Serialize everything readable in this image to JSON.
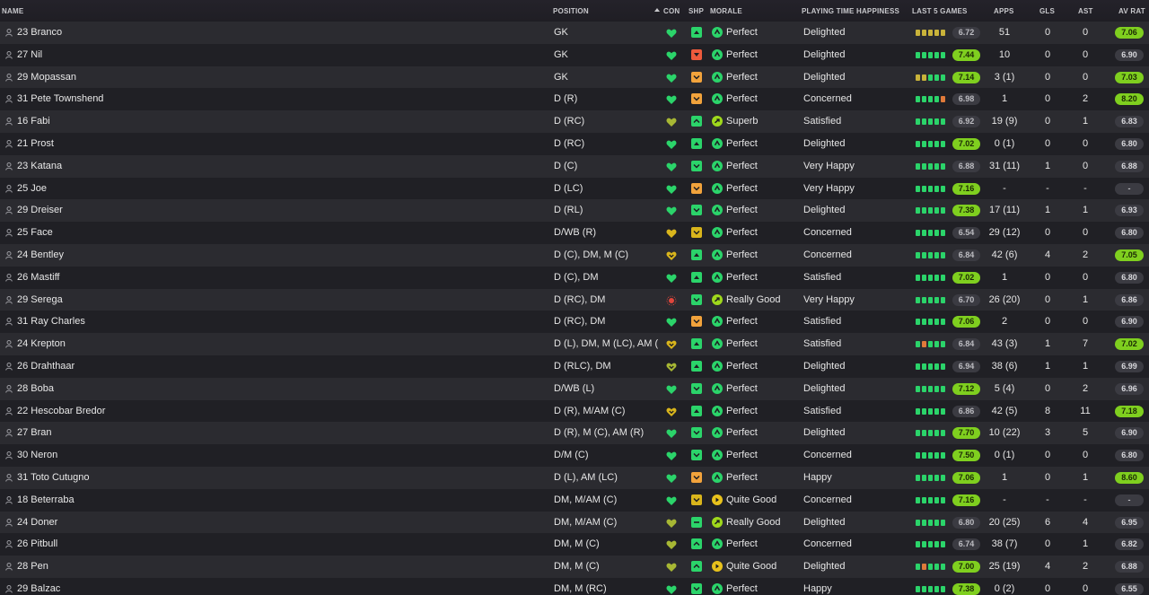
{
  "headers": {
    "name": "NAME",
    "position": "POSITION",
    "con": "CON",
    "shp": "SHP",
    "morale": "MORALE",
    "playing_time": "PLAYING TIME HAPPINESS",
    "last5": "LAST 5 GAMES",
    "apps": "APPS",
    "gls": "GLS",
    "ast": "AST",
    "av_rat": "AV RAT"
  },
  "colors": {
    "green": "#2bd46a",
    "lime": "#7fcf1f",
    "yellow": "#d9b51c",
    "orange": "#f2a33c",
    "red": "#ee5a3c",
    "olive": "#a7b734",
    "injury": "#e0463c"
  },
  "players": [
    {
      "name": "23 Branco",
      "position": "GK",
      "con": "green-heart",
      "shp": "green-up-small",
      "morale_icon": "green-up",
      "morale": "Perfect",
      "pt": "Delighted",
      "last5": [
        "yel",
        "yel",
        "yel",
        "yel",
        "yel"
      ],
      "last": "6.72",
      "last_hl": false,
      "apps": "51",
      "gls": "0",
      "ast": "0",
      "avr": "7.06",
      "avr_hl": true
    },
    {
      "name": "27 Nil",
      "position": "GK",
      "con": "green-heart",
      "shp": "red-down-small",
      "morale_icon": "green-up",
      "morale": "Perfect",
      "pt": "Delighted",
      "last5": [
        "grn",
        "grn",
        "grn",
        "grn",
        "grn"
      ],
      "last": "7.44",
      "last_hl": true,
      "apps": "10",
      "gls": "0",
      "ast": "0",
      "avr": "6.90",
      "avr_hl": false
    },
    {
      "name": "29 Mopassan",
      "position": "GK",
      "con": "green-heart",
      "shp": "orange-down",
      "morale_icon": "green-up",
      "morale": "Perfect",
      "pt": "Delighted",
      "last5": [
        "yel",
        "yel",
        "grn",
        "grn",
        "grn"
      ],
      "last": "7.14",
      "last_hl": true,
      "apps": "3 (1)",
      "gls": "0",
      "ast": "0",
      "avr": "7.03",
      "avr_hl": true
    },
    {
      "name": "31 Pete Townshend",
      "position": "D (R)",
      "con": "green-heart",
      "shp": "orange-down",
      "morale_icon": "green-up",
      "morale": "Perfect",
      "pt": "Concerned",
      "last5": [
        "grn",
        "grn",
        "grn",
        "grn",
        "ora"
      ],
      "last": "6.98",
      "last_hl": false,
      "apps": "1",
      "gls": "0",
      "ast": "2",
      "avr": "8.20",
      "avr_hl": true
    },
    {
      "name": "16 Fabi",
      "position": "D (RC)",
      "con": "lime-heart",
      "shp": "green-up-chev",
      "morale_icon": "lime-up",
      "morale": "Superb",
      "pt": "Satisfied",
      "last5": [
        "grn",
        "grn",
        "grn",
        "grn",
        "grn"
      ],
      "last": "6.92",
      "last_hl": false,
      "apps": "19 (9)",
      "gls": "0",
      "ast": "1",
      "avr": "6.83",
      "avr_hl": false
    },
    {
      "name": "21 Prost",
      "position": "D (RC)",
      "con": "green-heart",
      "shp": "green-up-small",
      "morale_icon": "green-up",
      "morale": "Perfect",
      "pt": "Delighted",
      "last5": [
        "grn",
        "grn",
        "grn",
        "grn",
        "grn"
      ],
      "last": "7.02",
      "last_hl": true,
      "apps": "0 (1)",
      "gls": "0",
      "ast": "0",
      "avr": "6.80",
      "avr_hl": false
    },
    {
      "name": "23 Katana",
      "position": "D (C)",
      "con": "green-heart",
      "shp": "green-down",
      "morale_icon": "green-up",
      "morale": "Perfect",
      "pt": "Very Happy",
      "last5": [
        "grn",
        "grn",
        "grn",
        "grn",
        "grn"
      ],
      "last": "6.88",
      "last_hl": false,
      "apps": "31 (11)",
      "gls": "1",
      "ast": "0",
      "avr": "6.88",
      "avr_hl": false
    },
    {
      "name": "25 Joe",
      "position": "D (LC)",
      "con": "green-heart",
      "shp": "orange-down",
      "morale_icon": "green-up",
      "morale": "Perfect",
      "pt": "Very Happy",
      "last5": [
        "grn",
        "grn",
        "grn",
        "grn",
        "grn"
      ],
      "last": "7.16",
      "last_hl": true,
      "apps": "-",
      "gls": "-",
      "ast": "-",
      "avr": "-",
      "avr_hl": false
    },
    {
      "name": "29 Dreiser",
      "position": "D (RL)",
      "con": "green-heart",
      "shp": "green-down",
      "morale_icon": "green-up",
      "morale": "Perfect",
      "pt": "Delighted",
      "last5": [
        "grn",
        "grn",
        "grn",
        "grn",
        "grn"
      ],
      "last": "7.38",
      "last_hl": true,
      "apps": "17 (11)",
      "gls": "1",
      "ast": "1",
      "avr": "6.93",
      "avr_hl": false
    },
    {
      "name": "25 Face",
      "position": "D/WB (R)",
      "con": "yellow-heart",
      "shp": "yellow-down",
      "morale_icon": "green-up",
      "morale": "Perfect",
      "pt": "Concerned",
      "last5": [
        "grn",
        "grn",
        "grn",
        "grn",
        "grn"
      ],
      "last": "6.54",
      "last_hl": false,
      "apps": "29 (12)",
      "gls": "0",
      "ast": "0",
      "avr": "6.80",
      "avr_hl": false
    },
    {
      "name": "24 Bentley",
      "position": "D (C), DM, M (C)",
      "con": "yellow-heart-down",
      "shp": "green-up-small",
      "morale_icon": "green-up",
      "morale": "Perfect",
      "pt": "Concerned",
      "last5": [
        "grn",
        "grn",
        "grn",
        "grn",
        "grn"
      ],
      "last": "6.84",
      "last_hl": false,
      "apps": "42 (6)",
      "gls": "4",
      "ast": "2",
      "avr": "7.05",
      "avr_hl": true
    },
    {
      "name": "26 Mastiff",
      "position": "D (C), DM",
      "con": "green-heart",
      "shp": "green-up-small",
      "morale_icon": "green-up",
      "morale": "Perfect",
      "pt": "Satisfied",
      "last5": [
        "grn",
        "grn",
        "grn",
        "grn",
        "grn"
      ],
      "last": "7.02",
      "last_hl": true,
      "apps": "1",
      "gls": "0",
      "ast": "0",
      "avr": "6.80",
      "avr_hl": false
    },
    {
      "name": "29 Serega",
      "position": "D (RC), DM",
      "con": "injury",
      "shp": "green-down",
      "morale_icon": "lime-up",
      "morale": "Really Good",
      "pt": "Very Happy",
      "last5": [
        "grn",
        "grn",
        "grn",
        "grn",
        "grn"
      ],
      "last": "6.70",
      "last_hl": false,
      "apps": "26 (20)",
      "gls": "0",
      "ast": "1",
      "avr": "6.86",
      "avr_hl": false
    },
    {
      "name": "31 Ray Charles",
      "position": "D (RC), DM",
      "con": "green-heart",
      "shp": "orange-down",
      "morale_icon": "green-up",
      "morale": "Perfect",
      "pt": "Satisfied",
      "last5": [
        "grn",
        "grn",
        "grn",
        "grn",
        "grn"
      ],
      "last": "7.06",
      "last_hl": true,
      "apps": "2",
      "gls": "0",
      "ast": "0",
      "avr": "6.90",
      "avr_hl": false
    },
    {
      "name": "24 Krepton",
      "position": "D (L), DM, M (LC), AM (…",
      "con": "yellow-heart-down",
      "shp": "green-up-small",
      "morale_icon": "green-up",
      "morale": "Perfect",
      "pt": "Satisfied",
      "last5": [
        "grn",
        "ora",
        "grn",
        "grn",
        "grn"
      ],
      "last": "6.84",
      "last_hl": false,
      "apps": "43 (3)",
      "gls": "1",
      "ast": "7",
      "avr": "7.02",
      "avr_hl": true
    },
    {
      "name": "26 Drahthaar",
      "position": "D (RLC), DM",
      "con": "lime-heart-down",
      "shp": "green-up-small",
      "morale_icon": "green-up",
      "morale": "Perfect",
      "pt": "Delighted",
      "last5": [
        "grn",
        "grn",
        "grn",
        "grn",
        "grn"
      ],
      "last": "6.94",
      "last_hl": false,
      "apps": "38 (6)",
      "gls": "1",
      "ast": "1",
      "avr": "6.99",
      "avr_hl": false
    },
    {
      "name": "28 Boba",
      "position": "D/WB (L)",
      "con": "green-heart",
      "shp": "green-down",
      "morale_icon": "green-up",
      "morale": "Perfect",
      "pt": "Delighted",
      "last5": [
        "grn",
        "grn",
        "grn",
        "grn",
        "grn"
      ],
      "last": "7.12",
      "last_hl": true,
      "apps": "5 (4)",
      "gls": "0",
      "ast": "2",
      "avr": "6.96",
      "avr_hl": false
    },
    {
      "name": "22 Hescobar Bredor",
      "position": "D (R), M/AM (C)",
      "con": "yellow-heart-down",
      "shp": "green-up-small",
      "morale_icon": "green-up",
      "morale": "Perfect",
      "pt": "Satisfied",
      "last5": [
        "grn",
        "grn",
        "grn",
        "grn",
        "grn"
      ],
      "last": "6.86",
      "last_hl": false,
      "apps": "42 (5)",
      "gls": "8",
      "ast": "11",
      "avr": "7.18",
      "avr_hl": true
    },
    {
      "name": "27 Bran",
      "position": "D (R), M (C), AM (R)",
      "con": "green-heart",
      "shp": "green-down",
      "morale_icon": "green-up",
      "morale": "Perfect",
      "pt": "Delighted",
      "last5": [
        "grn",
        "grn",
        "grn",
        "grn",
        "grn"
      ],
      "last": "7.70",
      "last_hl": true,
      "apps": "10 (22)",
      "gls": "3",
      "ast": "5",
      "avr": "6.90",
      "avr_hl": false
    },
    {
      "name": "30 Neron",
      "position": "D/M (C)",
      "con": "green-heart",
      "shp": "green-down",
      "morale_icon": "green-up",
      "morale": "Perfect",
      "pt": "Concerned",
      "last5": [
        "grn",
        "grn",
        "grn",
        "grn",
        "grn"
      ],
      "last": "7.50",
      "last_hl": true,
      "apps": "0 (1)",
      "gls": "0",
      "ast": "0",
      "avr": "6.80",
      "avr_hl": false
    },
    {
      "name": "31 Toto Cutugno",
      "position": "D (L), AM (LC)",
      "con": "green-heart",
      "shp": "orange-down",
      "morale_icon": "green-up",
      "morale": "Perfect",
      "pt": "Happy",
      "last5": [
        "grn",
        "grn",
        "grn",
        "grn",
        "grn"
      ],
      "last": "7.06",
      "last_hl": true,
      "apps": "1",
      "gls": "0",
      "ast": "1",
      "avr": "8.60",
      "avr_hl": true
    },
    {
      "name": "18 Beterraba",
      "position": "DM, M/AM (C)",
      "con": "green-heart",
      "shp": "yellow-down",
      "morale_icon": "yellow-right",
      "morale": "Quite Good",
      "pt": "Concerned",
      "last5": [
        "grn",
        "grn",
        "grn",
        "grn",
        "grn"
      ],
      "last": "7.16",
      "last_hl": true,
      "apps": "-",
      "gls": "-",
      "ast": "-",
      "avr": "-",
      "avr_hl": false
    },
    {
      "name": "24 Doner",
      "position": "DM, M/AM (C)",
      "con": "lime-heart",
      "shp": "green-flat",
      "morale_icon": "lime-up",
      "morale": "Really Good",
      "pt": "Delighted",
      "last5": [
        "grn",
        "grn",
        "grn",
        "grn",
        "grn"
      ],
      "last": "6.80",
      "last_hl": false,
      "apps": "20 (25)",
      "gls": "6",
      "ast": "4",
      "avr": "6.95",
      "avr_hl": false
    },
    {
      "name": "26 Pitbull",
      "position": "DM, M (C)",
      "con": "lime-heart",
      "shp": "green-up-chev",
      "morale_icon": "green-up",
      "morale": "Perfect",
      "pt": "Concerned",
      "last5": [
        "grn",
        "grn",
        "grn",
        "grn",
        "grn"
      ],
      "last": "6.74",
      "last_hl": false,
      "apps": "38 (7)",
      "gls": "0",
      "ast": "1",
      "avr": "6.82",
      "avr_hl": false
    },
    {
      "name": "28 Pen",
      "position": "DM, M (C)",
      "con": "lime-heart",
      "shp": "green-up-chev",
      "morale_icon": "yellow-right",
      "morale": "Quite Good",
      "pt": "Delighted",
      "last5": [
        "grn",
        "ora",
        "grn",
        "grn",
        "grn"
      ],
      "last": "7.00",
      "last_hl": true,
      "apps": "25 (19)",
      "gls": "4",
      "ast": "2",
      "avr": "6.88",
      "avr_hl": false
    },
    {
      "name": "29 Balzac",
      "position": "DM, M (RC)",
      "con": "green-heart",
      "shp": "green-down",
      "morale_icon": "green-up",
      "morale": "Perfect",
      "pt": "Happy",
      "last5": [
        "grn",
        "grn",
        "grn",
        "grn",
        "grn"
      ],
      "last": "7.38",
      "last_hl": true,
      "apps": "0 (2)",
      "gls": "0",
      "ast": "0",
      "avr": "6.55",
      "avr_hl": false
    }
  ]
}
